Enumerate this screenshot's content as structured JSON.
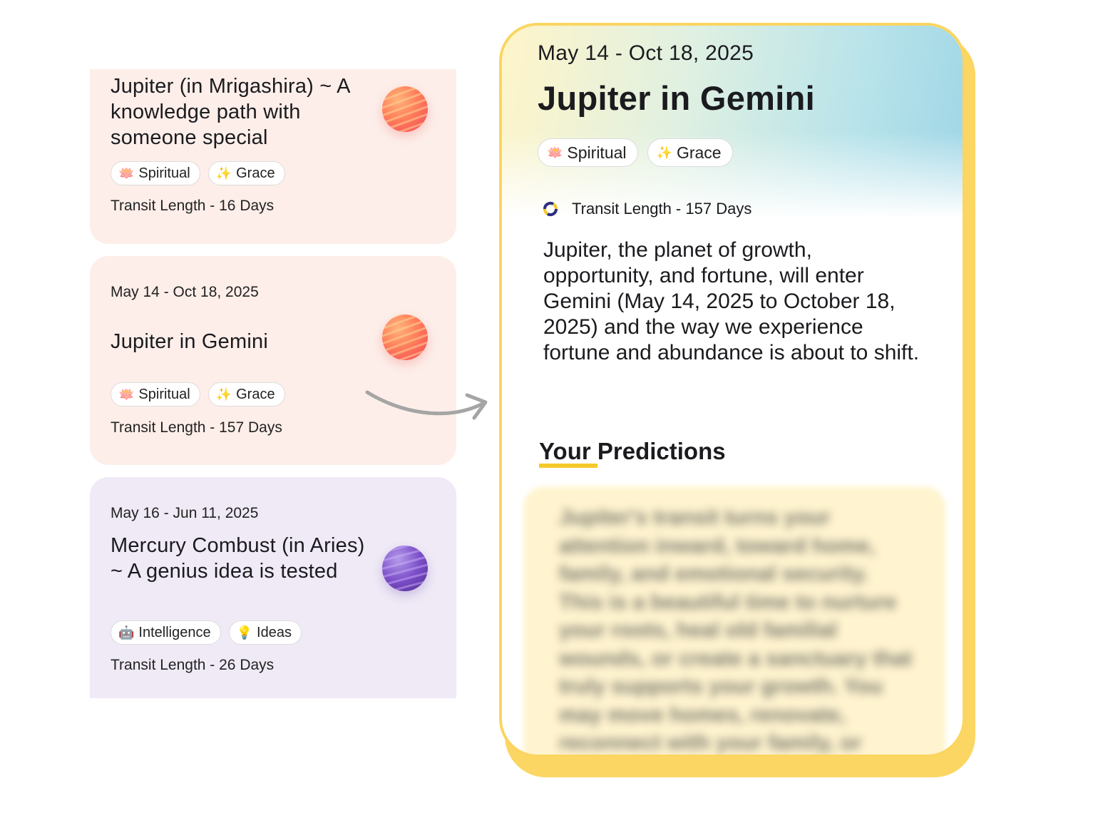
{
  "cards": [
    {
      "title": "Jupiter (in Mrigashira) ~ A knowledge path with someone special",
      "tags": [
        {
          "icon": "🪷",
          "label": "Spiritual"
        },
        {
          "icon": "✨",
          "label": "Grace"
        }
      ],
      "transit": "Transit Length - 16 Days",
      "planet": "orange-planet-icon"
    },
    {
      "date": "May 14 - Oct 18, 2025",
      "title": "Jupiter in Gemini",
      "tags": [
        {
          "icon": "🪷",
          "label": "Spiritual"
        },
        {
          "icon": "✨",
          "label": "Grace"
        }
      ],
      "transit": "Transit Length - 157 Days",
      "planet": "orange-planet-icon"
    },
    {
      "date": "May 16 - Jun 11, 2025",
      "title": "Mercury Combust (in Aries) ~ A genius idea is tested",
      "tags": [
        {
          "icon": "🤖",
          "label": "Intelligence"
        },
        {
          "icon": "💡",
          "label": "Ideas"
        }
      ],
      "transit": "Transit Length - 26 Days",
      "planet": "purple-planet-icon"
    }
  ],
  "detail": {
    "date": "May 14 - Oct 18, 2025",
    "title": "Jupiter in Gemini",
    "tags": [
      {
        "icon": "🪷",
        "label": "Spiritual"
      },
      {
        "icon": "✨",
        "label": "Grace"
      }
    ],
    "transit": "Transit Length - 157 Days",
    "body": "Jupiter, the planet of growth, opportunity, and fortune, will enter Gemini (May 14, 2025 to October 18, 2025) and the way we experience fortune and abundance is about to shift.",
    "predictions_heading": "Your Predictions",
    "predictions_blurred": "Jupiter's transit turns your attention inward, toward home, family, and emotional security. This is a beautiful time to nurture your roots, heal old familial wounds, or create a sanctuary that truly supports your growth. You may move homes, renovate, reconnect with your family, or"
  },
  "colors": {
    "card_peach": "#fdeee9",
    "card_lavender": "#efeaf6",
    "panel_border": "#fbd560",
    "underline": "#f5c928"
  }
}
